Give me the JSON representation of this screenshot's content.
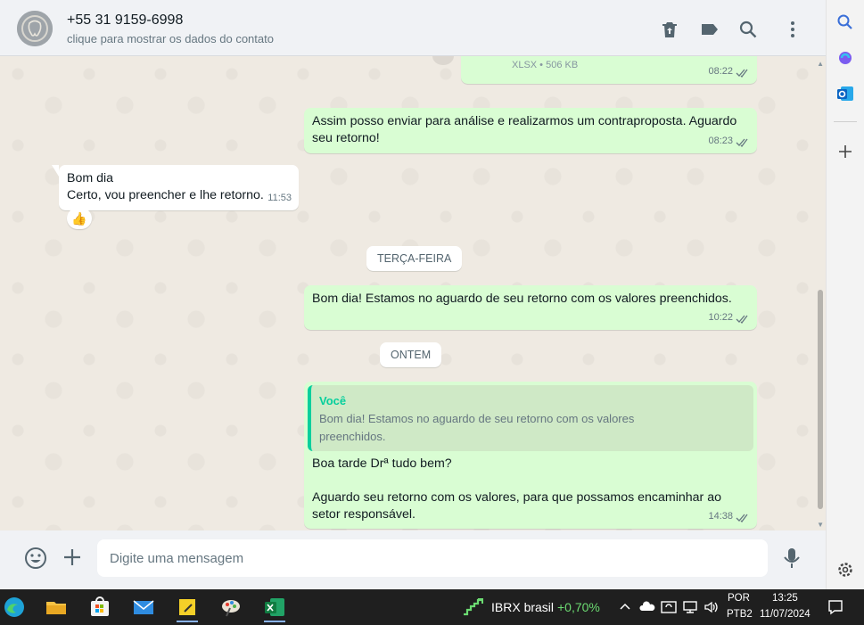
{
  "header": {
    "contact_name": "+55 31 9159-6998",
    "contact_subtitle": "clique para mostrar os dados do contato",
    "icons": [
      "delete-icon",
      "label-icon",
      "search-icon",
      "menu-icon"
    ]
  },
  "messages": {
    "file_meta": "XLSX • 506 KB",
    "file_time": "08:22",
    "m1_text": "Assim posso enviar para análise e realizarmos um contraproposta. Aguardo seu retorno!",
    "m1_time": "08:23",
    "m2_text": "Bom dia\nCerto, vou preencher e lhe retorno.",
    "m2_time": "11:53",
    "m2_reaction": "👍",
    "day1": "TERÇA-FEIRA",
    "m3_text": "Bom dia! Estamos no aguardo de seu retorno com os valores preenchidos.",
    "m3_time": "10:22",
    "day2": "ONTEM",
    "m4_quote_author": "Você",
    "m4_quote_text": "Bom dia! Estamos no aguardo de seu retorno com os valores preenchidos.",
    "m4_text": "Boa tarde Drª tudo bem?\n\nAguardo seu retorno com os valores, para que possamos encaminhar ao setor responsável.",
    "m4_time": "14:38"
  },
  "composer": {
    "placeholder": "Digite uma mensagem"
  },
  "sidepanel": {
    "icons": [
      "search-icon",
      "copilot-icon",
      "outlook-icon",
      "add-icon",
      "settings-icon"
    ]
  },
  "taskbar": {
    "apps": [
      "edge-icon",
      "file-explorer-icon",
      "store-icon",
      "mail-icon",
      "sticky-notes-icon",
      "paint-icon",
      "excel-icon"
    ],
    "stock_name": "IBRX brasil",
    "stock_change": "+0,70%",
    "lang_line1": "POR",
    "lang_line2": "PTB2",
    "time": "13:25",
    "date": "11/07/2024",
    "colors": {
      "stock_up": "#6cdb72",
      "accent": "#8ab4f8"
    }
  },
  "colors": {
    "outgoing_bubble": "#d9fdd3",
    "incoming_bubble": "#ffffff",
    "chat_background": "#efeae2",
    "quote_accent": "#06cf9c",
    "read_ticks": "#667781"
  }
}
